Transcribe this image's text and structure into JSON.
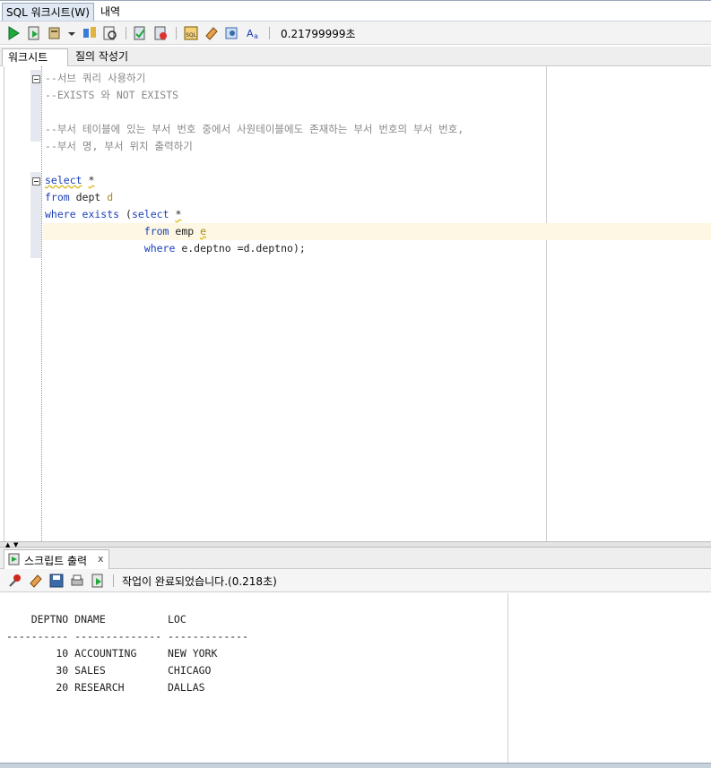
{
  "titlebar": {
    "tabs": [
      {
        "label": "SQL 워크시트(W)"
      },
      {
        "label": "내역"
      }
    ]
  },
  "toolbar": {
    "elapsed": "0.21799999초"
  },
  "subtabs": {
    "worksheet": "워크시트",
    "query_builder": "질의 작성기"
  },
  "editor": {
    "lines": [
      {
        "c": "--서브 쿼리 사용하기"
      },
      {
        "c": "--EXISTS 와 NOT EXISTS"
      },
      {
        "c": ""
      },
      {
        "c": "--부서 테이블에 있는 부서 번호 중에서 사원테이블에도 존재하는 부서 번호의 부서 번호,"
      },
      {
        "c": "--부서 명, 부서 위치 출력하기"
      },
      {
        "c": ""
      },
      {
        "t": [
          "select",
          " ",
          "*"
        ]
      },
      {
        "t": [
          "from",
          " dept ",
          "d"
        ]
      },
      {
        "t": [
          "where exists",
          " (",
          "select",
          " ",
          "*"
        ]
      },
      {
        "t": [
          "                ",
          "from",
          " emp ",
          "e"
        ]
      },
      {
        "t": [
          "                ",
          "where",
          " e.deptno =d.deptno);"
        ]
      }
    ]
  },
  "output_panel": {
    "tab_label": "스크립트 출력",
    "close": "x",
    "status": "작업이 완료되었습니다.(0.218초)",
    "lines": [
      "",
      "    DEPTNO DNAME          LOC",
      "---------- -------------- -------------",
      "        10 ACCOUNTING     NEW YORK",
      "        30 SALES          CHICAGO",
      "        20 RESEARCH       DALLAS"
    ]
  },
  "colors": {
    "keyword": "#1a3fb8",
    "comment": "#888888",
    "alias": "#a88a1c",
    "current_line": "#fdf7e3"
  }
}
